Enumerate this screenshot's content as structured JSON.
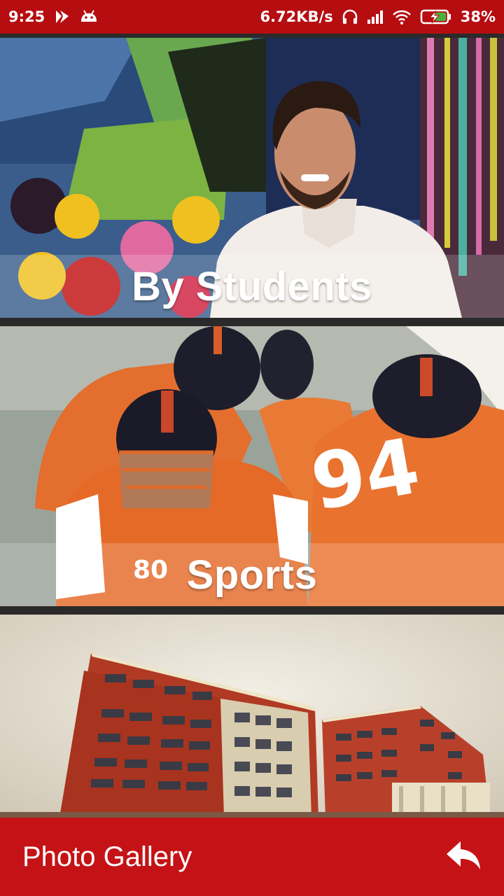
{
  "status_bar": {
    "time": "9:25",
    "network_speed": "6.72KB/s",
    "battery": "38%",
    "icons": [
      "notification-flag-icon",
      "android-icon",
      "headphones-icon",
      "signal-icon",
      "wifi-icon",
      "battery-charging-icon"
    ]
  },
  "cards": [
    {
      "id": "by-students",
      "label": "By Students",
      "image": "student-portrait-mural"
    },
    {
      "id": "sports",
      "label": "Sports",
      "image": "american-football-players"
    },
    {
      "id": "campus",
      "label": "",
      "image": "red-brick-campus-building"
    }
  ],
  "bottom_bar": {
    "title": "Photo Gallery",
    "back_icon": "reply-arrow-icon"
  },
  "colors": {
    "status_bar": "#b60d11",
    "bottom_bar": "#c51216",
    "background": "#2a2a2a"
  }
}
